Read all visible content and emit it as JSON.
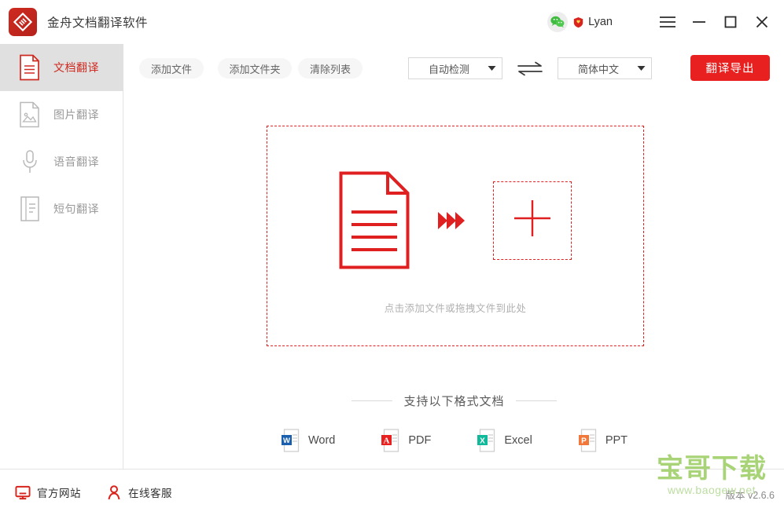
{
  "titlebar": {
    "app_title": "金舟文档翻译软件",
    "logo_icon": "jinzhou-logo-icon",
    "user": {
      "wechat_icon": "wechat-icon",
      "vip_icon": "vip-badge-icon",
      "name": "Lyan"
    },
    "window_controls": {
      "menu_icon": "hamburger-menu-icon",
      "minimize_icon": "minimize-icon",
      "maximize_icon": "maximize-icon",
      "close_icon": "close-icon"
    }
  },
  "sidebar": {
    "items": [
      {
        "label": "文档翻译",
        "icon": "document-icon",
        "active": true
      },
      {
        "label": "图片翻译",
        "icon": "image-icon",
        "active": false
      },
      {
        "label": "语音翻译",
        "icon": "microphone-icon",
        "active": false
      },
      {
        "label": "短句翻译",
        "icon": "short-text-icon",
        "active": false
      }
    ]
  },
  "toolbar": {
    "add_file_label": "添加文件",
    "add_folder_label": "添加文件夹",
    "clear_list_label": "清除列表",
    "source_lang": "自动检测",
    "target_lang": "简体中文",
    "swap_icon": "swap-languages-icon",
    "caret_icon": "chevron-down-icon",
    "translate_export_label": "翻译导出"
  },
  "dropzone": {
    "document_icon": "document-page-icon",
    "arrows_icon": "triple-chevron-right-icon",
    "plus_icon": "plus-icon",
    "hint": "点击添加文件或拖拽文件到此处"
  },
  "formats": {
    "title": "支持以下格式文档",
    "items": [
      {
        "name": "Word",
        "badge": "W",
        "color": "#1a5fad",
        "icon": "word-file-icon"
      },
      {
        "name": "PDF",
        "badge": "A",
        "color": "#e8201f",
        "icon": "pdf-file-icon"
      },
      {
        "name": "Excel",
        "badge": "X",
        "color": "#0fb99a",
        "icon": "excel-file-icon"
      },
      {
        "name": "PPT",
        "badge": "P",
        "color": "#f2773a",
        "icon": "ppt-file-icon"
      }
    ]
  },
  "footer": {
    "official_site_label": "官方网站",
    "official_site_icon": "monitor-icon",
    "online_support_label": "在线客服",
    "online_support_icon": "person-icon",
    "version": "版本 v2.6.6"
  },
  "watermark": {
    "main": "宝哥下载",
    "url": "www.baogew.net"
  },
  "colors": {
    "brand_red": "#e8201f",
    "logo_red": "#cf2a20",
    "active_bg": "#e0e0e0",
    "watermark_green": "#a8d477"
  }
}
